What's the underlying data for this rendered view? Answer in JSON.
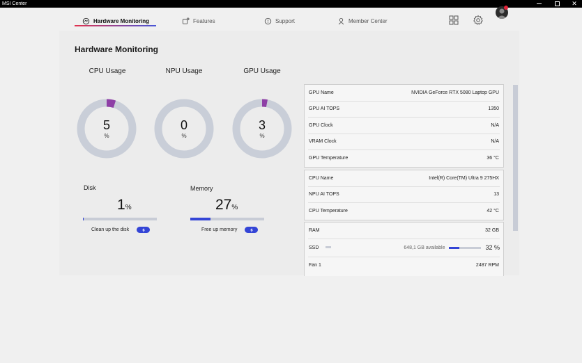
{
  "window": {
    "title": "MSI Center"
  },
  "nav": {
    "tabs": [
      {
        "label": "Hardware Monitoring",
        "icon": "monitor-circle-icon",
        "active": true
      },
      {
        "label": "Features",
        "icon": "features-icon"
      },
      {
        "label": "Support",
        "icon": "support-icon"
      },
      {
        "label": "Member Center",
        "icon": "member-icon"
      }
    ],
    "accent_gradient": [
      "#e2334f",
      "#4856d8"
    ]
  },
  "page": {
    "title": "Hardware Monitoring"
  },
  "gauges": [
    {
      "label": "CPU Usage",
      "value": "5",
      "unit": "%",
      "percent": 5
    },
    {
      "label": "NPU Usage",
      "value": "0",
      "unit": "%",
      "percent": 0
    },
    {
      "label": "GPU Usage",
      "value": "3",
      "unit": "%",
      "percent": 3
    }
  ],
  "gauge_colors": {
    "track": "#c9ced8",
    "fill": "#8e3fa6"
  },
  "disk": {
    "label": "Disk",
    "value": "1",
    "unit": "%",
    "percent": 1,
    "action": "Clean up the disk"
  },
  "memory": {
    "label": "Memory",
    "value": "27",
    "unit": "%",
    "percent": 27,
    "action": "Free up memory"
  },
  "gpu_info": [
    {
      "label": "GPU Name",
      "value": "NVIDIA GeForce RTX 5080 Laptop GPU"
    },
    {
      "label": "GPU AI TOPS",
      "value": "1350"
    },
    {
      "label": "GPU Clock",
      "value": "N/A"
    },
    {
      "label": "VRAM Clock",
      "value": "N/A"
    },
    {
      "label": "GPU Temperature",
      "value": "36 °C"
    }
  ],
  "cpu_info": [
    {
      "label": "CPU Name",
      "value": "Intel(R) Core(TM) Ultra 9 275HX"
    },
    {
      "label": "NPU AI TOPS",
      "value": "13"
    },
    {
      "label": "CPU Temperature",
      "value": "42 °C"
    }
  ],
  "system_info": {
    "ram": {
      "label": "RAM",
      "value": "32 GB"
    },
    "ssd": {
      "label": "SSD",
      "available": "648,1 GB available",
      "percent_text": "32 %",
      "percent": 32
    },
    "fan": {
      "label": "Fan 1",
      "value": "2487 RPM"
    }
  },
  "colors": {
    "primary": "#3445d6"
  }
}
